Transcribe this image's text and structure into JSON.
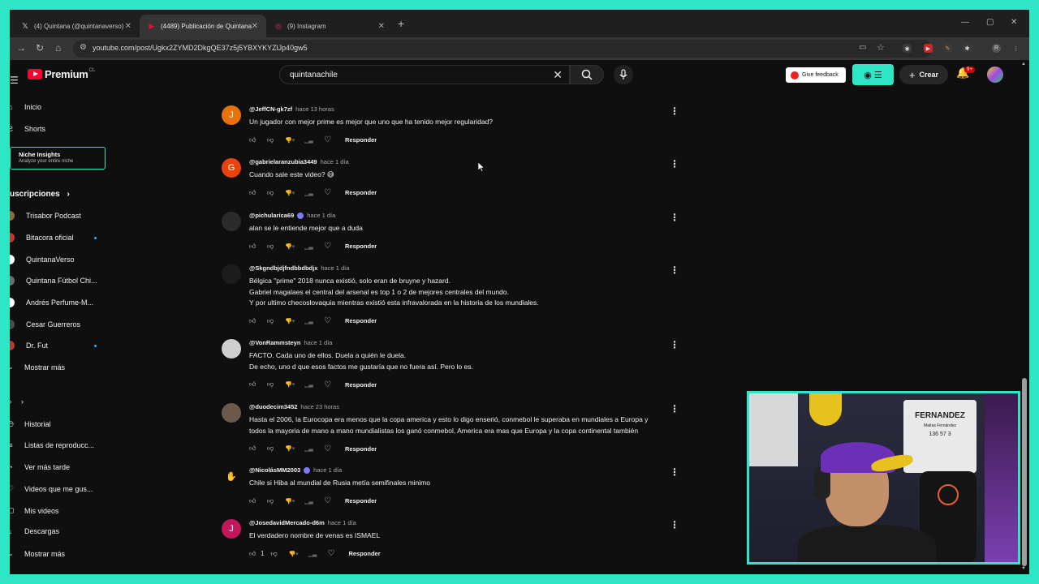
{
  "browser": {
    "tabs": [
      {
        "label": "(4) Quintana (@quintanaverso)",
        "icon": "x-logo-icon",
        "active": false
      },
      {
        "label": "(4489) Publicación de Quintana",
        "icon": "youtube-icon",
        "active": true
      },
      {
        "label": "(9) Instagram",
        "icon": "instagram-icon",
        "active": false
      }
    ],
    "url": "youtube.com/post/Ugkx2ZYMD2DkgQE37z5j5YBXYKYZlJp40gw5"
  },
  "header": {
    "logo_text": "Premium",
    "region": "CL",
    "search_value": "quintanachile",
    "feedback_label": "Give feedback",
    "create_label": "Crear",
    "notif_count": "9+"
  },
  "sidebar": {
    "main": [
      {
        "label": "Inicio",
        "icon": "home-icon"
      },
      {
        "label": "Shorts",
        "icon": "shorts-icon"
      }
    ],
    "niche": {
      "title": "Niche Insights",
      "subtitle": "Analyze your entire niche"
    },
    "subs_heading": "uscripciones",
    "subs": [
      {
        "label": "Trisabor Podcast",
        "color": "#8a6d3b",
        "new": false
      },
      {
        "label": "Bitacora oficial",
        "color": "#c0392b",
        "new": true
      },
      {
        "label": "QuintanaVerso",
        "color": "#ffffff",
        "new": false
      },
      {
        "label": "Quintana Fútbol Chi...",
        "color": "#6d6d6d",
        "new": false
      },
      {
        "label": "Andrés Perfume-M...",
        "color": "#ffffff",
        "new": false
      },
      {
        "label": "Cesar Guerreros",
        "color": "#4a4a4a",
        "new": false
      },
      {
        "label": "Dr. Fut",
        "color": "#b03a2e",
        "new": true
      }
    ],
    "show_more_1": "Mostrar más",
    "you_items": [
      {
        "label": "Historial",
        "icon": "history-icon"
      },
      {
        "label": "Listas de reproducc...",
        "icon": "playlist-icon"
      },
      {
        "label": "Ver más tarde",
        "icon": "clock-icon"
      },
      {
        "label": "Videos que me gus...",
        "icon": "thumbs-up-icon"
      },
      {
        "label": "Mis videos",
        "icon": "video-icon"
      },
      {
        "label": "Descargas",
        "icon": "download-icon"
      }
    ],
    "show_more_2": "Mostrar más"
  },
  "comments": [
    {
      "user": "@JeffCN-gk7zf",
      "time": "hace 13 horas",
      "lines": [
        "Un jugador con mejor prime es mejor que uno que ha tenido mejor regularidad?"
      ],
      "avatar_letter": "J",
      "avatar_color": "#e8710a",
      "likes": "",
      "verified": false
    },
    {
      "user": "@gabrielaranzubia3449",
      "time": "hace 1 día",
      "lines": [
        "Cuando sale este video? 😅"
      ],
      "avatar_letter": "G",
      "avatar_color": "#e8430a",
      "likes": "",
      "verified": false
    },
    {
      "user": "@pichularica69",
      "time": "hace 1 día",
      "lines": [
        "alan se le entiende mejor que a duda"
      ],
      "avatar_letter": "",
      "avatar_color": "#2b2b2b",
      "likes": "",
      "verified": true
    },
    {
      "user": "@Skgndbjdjfndbbdbdjx",
      "time": "hace 1 día",
      "lines": [
        "Bélgica \"prime\" 2018 nunca existió, solo eran de bruyne y hazard.",
        "Gabriel magalaes el central del arsenal es top 1 o 2 de mejores centrales del mundo.",
        "Y por ultimo checoslovaquia mientras existió esta infravalorada en la historia de los mundiales."
      ],
      "avatar_letter": "",
      "avatar_color": "#1c1c1c",
      "likes": "",
      "verified": false
    },
    {
      "user": "@VonRammsteyn",
      "time": "hace 1 día",
      "lines": [
        "FACTO. Cada uno de ellos. Duela a quién le duela.",
        "De echo, uno d que esos factos me gustaría que no fuera así. Pero lo es."
      ],
      "avatar_letter": "",
      "avatar_color": "#cfcfcf",
      "likes": "",
      "verified": false
    },
    {
      "user": "@duodecim3452",
      "time": "hace 23 horas",
      "lines": [
        "Hasta el 2006, la Eurocopa era menos que la copa america y esto lo digo enserió, conmebol le superaba en mundiales a Europa y",
        "todos la mayoria de mano a mano mundialistas los ganó conmebol, America era mas que Europa y la copa continental también"
      ],
      "avatar_letter": "",
      "avatar_color": "#6b5a4a",
      "likes": "",
      "verified": false
    },
    {
      "user": "@NicolásMM2003",
      "time": "hace 1 día",
      "lines": [
        "Chile si Hiba al mundial de Rusia metía semifinales minimo"
      ],
      "avatar_letter": "",
      "avatar_color": "#0f0f0f",
      "likes": "",
      "verified": true
    },
    {
      "user": "@JosedavidMercado-d6m",
      "time": "hace 1 día",
      "lines": [
        "El verdadero nombre de venas es ISMAEL"
      ],
      "avatar_letter": "J",
      "avatar_color": "#c2185b",
      "likes": "1",
      "verified": false
    }
  ],
  "reply_label": "Responder",
  "webcam": {
    "jersey_name": "FERNANDEZ",
    "jersey_sub": "Matías Fernández",
    "jersey_nums": "136 57 3"
  }
}
